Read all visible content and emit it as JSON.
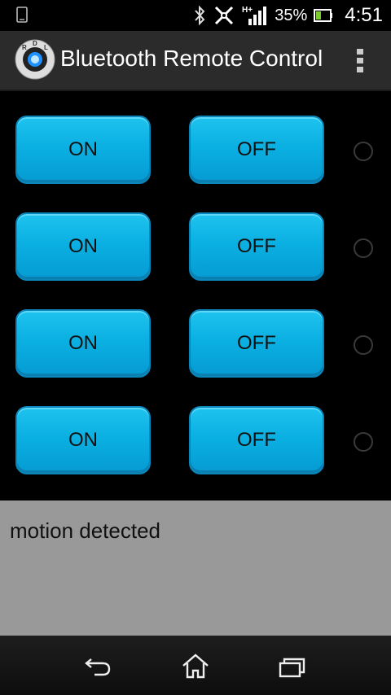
{
  "status_bar": {
    "battery_percent": "35%",
    "time": "4:51",
    "icons": [
      "phone-icon",
      "bluetooth-icon",
      "nfc-icon",
      "hplus-signal-icon",
      "battery-icon"
    ]
  },
  "action_bar": {
    "title": "Bluetooth Remote Control",
    "app_icon": "rdl-app-icon",
    "overflow_icon": "overflow-menu-icon"
  },
  "controls": {
    "rows": [
      {
        "on_label": "ON",
        "off_label": "OFF",
        "indicator_on": false
      },
      {
        "on_label": "ON",
        "off_label": "OFF",
        "indicator_on": false
      },
      {
        "on_label": "ON",
        "off_label": "OFF",
        "indicator_on": false
      },
      {
        "on_label": "ON",
        "off_label": "OFF",
        "indicator_on": false
      }
    ]
  },
  "log": {
    "text": "motion detected"
  },
  "nav_bar": {
    "icons": [
      "back-icon",
      "home-icon",
      "recent-apps-icon"
    ]
  },
  "colors": {
    "button": "#0bb0e2",
    "log_background": "#999999",
    "action_bar": "#2b2b2b"
  },
  "app_icon_letters": "RDL"
}
